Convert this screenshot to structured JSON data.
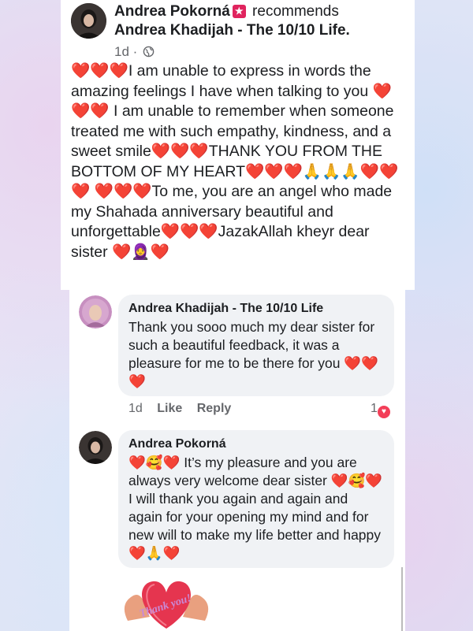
{
  "post": {
    "author": "Andrea Pokorná",
    "action": "recommends",
    "page": "Andrea Khadijah - The 10/10 Life.",
    "time": "1d ·",
    "text": "❤️❤️❤️I am unable to express in words the amazing feelings I have when talking to you ❤️❤️❤️ I am unable to remember when someone treated me with such empathy, kindness, and a sweet smile❤️❤️❤️THANK YOU FROM THE BOTTOM OF MY HEART❤️❤️❤️🙏🙏🙏❤️❤️❤️ ❤️❤️❤️To me, you are an angel who made my Shahada anniversary beautiful and unforgettable❤️❤️❤️JazakAllah kheyr dear sister ❤️🧕❤️"
  },
  "comments": [
    {
      "name": "Andrea Khadijah - The 10/10 Life",
      "text": "Thank you sooo much my dear sister for such a beautiful feedback, it was a pleasure for me to be there for you ❤️❤️❤️",
      "time": "1d",
      "like": "Like",
      "reply": "Reply",
      "reactions": "1"
    },
    {
      "name": "Andrea Pokorná",
      "text": "❤️🥰❤️ It’s my pleasure and you are always very welcome dear sister ❤️🥰❤️ I will thank you again and again and again for your opening my mind and for new will to make my life better and happy ❤️🙏❤️"
    }
  ],
  "sticker": {
    "text": "Thank you!"
  },
  "colors": {
    "reaction_heart": "#f33e58",
    "bubble": "#f0f2f5",
    "meta": "#65676b"
  }
}
